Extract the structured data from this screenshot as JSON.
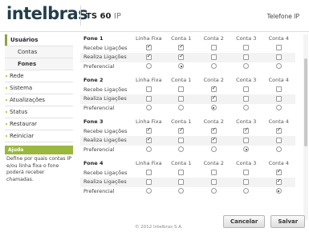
{
  "header": {
    "logo": "intelbras",
    "model": "TS 60",
    "model_suffix": "IP",
    "right_title": "Telefone IP"
  },
  "sidebar": {
    "section": "Usuários",
    "subitems": [
      "Contas",
      "Fones"
    ],
    "items": [
      "Rede",
      "Sistema",
      "Atualizações",
      "Status",
      "Restaurar",
      "Reiniciar"
    ],
    "accent": "#9bb73d"
  },
  "help": {
    "title": "Ajuda",
    "text": "Define por quais contas IP e/ou linha fixa o fone poderá receber chamadas."
  },
  "columns": [
    "Linha Fixa",
    "Conta 1",
    "Conta 2",
    "Conta 3",
    "Conta 4"
  ],
  "row_labels": [
    "Recebe Ligações",
    "Realiza Ligações",
    "Preferencial"
  ],
  "phones": [
    {
      "name": "Fone 1",
      "recebe": [
        true,
        true,
        false,
        false,
        false
      ],
      "realiza": [
        true,
        true,
        false,
        false,
        false
      ],
      "preferencial": 1
    },
    {
      "name": "Fone 2",
      "recebe": [
        false,
        false,
        true,
        false,
        false
      ],
      "realiza": [
        false,
        false,
        true,
        false,
        false
      ],
      "preferencial": 2
    },
    {
      "name": "Fone 3",
      "recebe": [
        true,
        true,
        true,
        true,
        true
      ],
      "realiza": [
        true,
        false,
        true,
        false,
        false
      ],
      "preferencial": 3
    },
    {
      "name": "Fone 4",
      "recebe": [
        false,
        false,
        false,
        false,
        true
      ],
      "realiza": [
        false,
        false,
        false,
        false,
        true
      ],
      "preferencial": 4
    }
  ],
  "buttons": {
    "cancel": "Cancelar",
    "save": "Salvar"
  },
  "footer": "© 2012 Intelbras S.A."
}
